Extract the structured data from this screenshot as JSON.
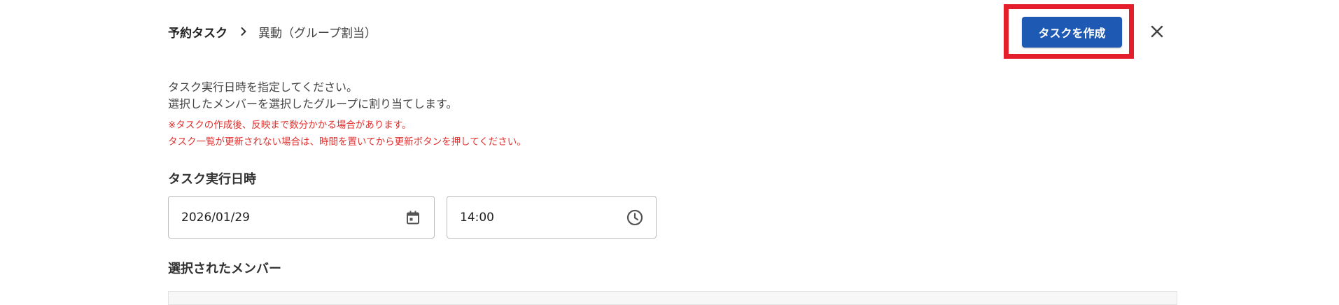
{
  "breadcrumb": {
    "root": "予約タスク",
    "current": "異動（グループ割当）",
    "separator_icon": "chevron-right-icon"
  },
  "header": {
    "create_button_label": "タスクを作成",
    "close_icon": "close-icon",
    "highlight_color": "#e41e2b",
    "button_color": "#1e59b4"
  },
  "intro": {
    "line1": "タスク実行日時を指定してください。",
    "line2": "選択したメンバーを選択したグループに割り当てします。"
  },
  "notes": {
    "line1": "※タスクの作成後、反映まで数分かかる場合があります。",
    "line2": "タスク一覧が更新されない場合は、時間を置いてから更新ボタンを押してください。",
    "color": "#e0312f"
  },
  "schedule": {
    "heading": "タスク実行日時",
    "date_value": "2026/01/29",
    "date_icon": "calendar-icon",
    "time_value": "14:00",
    "time_icon": "clock-icon"
  },
  "members": {
    "heading": "選択されたメンバー"
  }
}
